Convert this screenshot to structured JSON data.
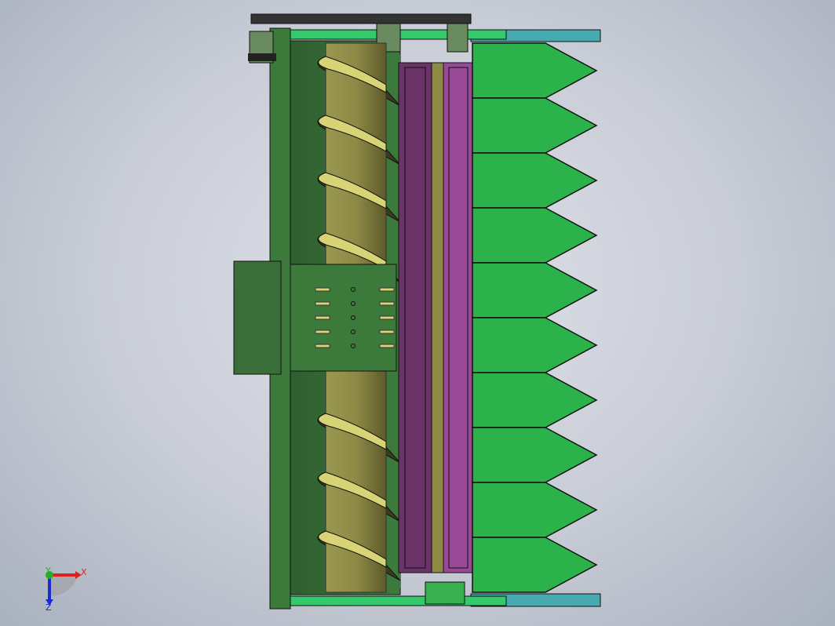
{
  "viewport": {
    "view_orientation": "top"
  },
  "model": {
    "teeth_count": 10,
    "flight_count": 7
  },
  "triad": {
    "x_label": "X",
    "y_label": "Y",
    "z_label": "Z"
  },
  "colors": {
    "frame_green": "#3c7a3c",
    "tooth_green": "#2cb24a",
    "auger_olive": "#8e8a46",
    "flight_yellow": "#d8d476",
    "purple_dark": "#6a3468",
    "purple_light": "#984a96",
    "rail_teal": "#46aab0",
    "x_axis": "#e02020",
    "y_axis": "#22b022",
    "z_axis": "#1a2cd0"
  }
}
